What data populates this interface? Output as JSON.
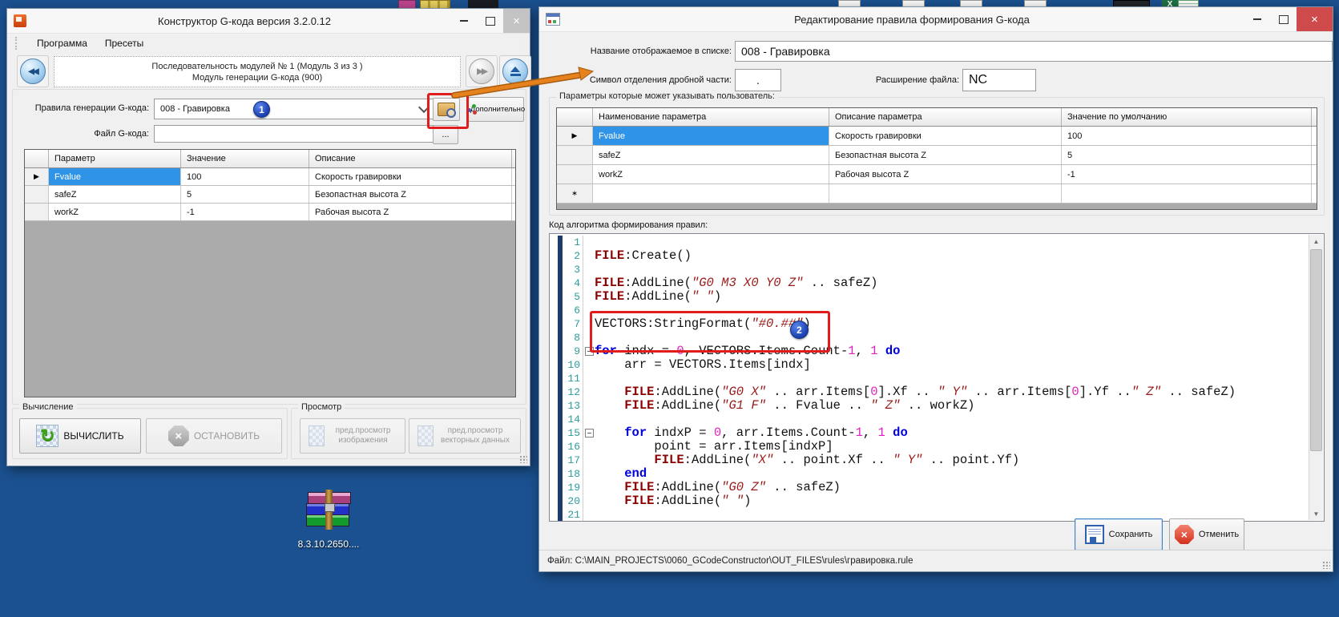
{
  "desktop": {
    "winrar_icon_label": "8.3.10.2650...."
  },
  "colors": {
    "desktop_bg": "#1b5190",
    "selection_blue": "#2f93e8",
    "annotation_red": "#e01d1d",
    "annotation_orange": "#e5821e",
    "close_button_red": "#cf4b4b",
    "code_keyword": "#0000dd",
    "code_type": "#8b0000",
    "code_string": "#9b1a1a",
    "code_number": "#e020c0",
    "line_number_teal": "#2c9c9c"
  },
  "left_window": {
    "title": "Конструктор G-кода версия 3.2.0.12",
    "menu": [
      "Программа",
      "Пресеты"
    ],
    "nav": {
      "line1": "Последовательность модулей № 1 (Модуль 3 из 3 )",
      "line2": "Модуль генерации G-кода (900)"
    },
    "fields": {
      "rules_label": "Правила генерации G-кода:",
      "rules_value": "008 - Гравировка",
      "badge1": "1",
      "advanced_label": "Дополнительно",
      "file_label": "Файл G-кода:",
      "file_value": "",
      "browse_label": "..."
    },
    "table": {
      "columns": [
        "Параметр",
        "Значение",
        "Описание"
      ],
      "rows": [
        {
          "cells": [
            "Fvalue",
            "100",
            "Скорость гравировки"
          ],
          "selected": true
        },
        {
          "cells": [
            "safeZ",
            "5",
            "Безопастная высота Z"
          ],
          "selected": false
        },
        {
          "cells": [
            "workZ",
            "-1",
            "Рабочая высота Z"
          ],
          "selected": false
        }
      ]
    },
    "compute_group": {
      "label": "Вычисление",
      "run_label": "ВЫЧИСЛИТЬ",
      "stop_label": "ОСТАНОВИТЬ"
    },
    "preview_group": {
      "label": "Просмотр",
      "preview_image_label": "пред.просмотр изображения",
      "preview_vector_label": "пред.просмотр векторных данных"
    }
  },
  "right_window": {
    "title": "Редактирование правила формирования G-кода",
    "fields": {
      "name_label": "Название отображаемое в списке:",
      "name_value": "008 - Гравировка",
      "decimal_label": "Символ отделения дробной части:",
      "decimal_value": ".",
      "ext_label": "Расширение файла:",
      "ext_value": "NC"
    },
    "params_group": {
      "label": "Параметры которые может указывать пользователь:",
      "columns": [
        "Наименование параметра",
        "Описание параметра",
        "Значение по умолчанию"
      ],
      "rows": [
        {
          "cells": [
            "Fvalue",
            "Скорость гравировки",
            "100"
          ],
          "selected": true
        },
        {
          "cells": [
            "safeZ",
            "Безопастная высота Z",
            "5"
          ],
          "selected": false
        },
        {
          "cells": [
            "workZ",
            "Рабочая высота Z",
            "-1"
          ],
          "selected": false
        }
      ],
      "new_row_glyph": "∗"
    },
    "code": {
      "label": "Код алгоритма формирования правил:",
      "badge2": "2",
      "lines": [
        {
          "n": "1",
          "seg": []
        },
        {
          "n": "2",
          "seg": [
            [
              "t",
              "FILE"
            ],
            [
              "p",
              ":Create()"
            ]
          ]
        },
        {
          "n": "3",
          "seg": []
        },
        {
          "n": "4",
          "seg": [
            [
              "t",
              "FILE"
            ],
            [
              "p",
              ":AddLine("
            ],
            [
              "s",
              "\"G0 M3 X0 Y0 Z\""
            ],
            [
              "p",
              " .. safeZ)"
            ]
          ]
        },
        {
          "n": "5",
          "seg": [
            [
              "t",
              "FILE"
            ],
            [
              "p",
              ":AddLine("
            ],
            [
              "s",
              "\" \""
            ],
            [
              "p",
              ")"
            ]
          ]
        },
        {
          "n": "6",
          "seg": []
        },
        {
          "n": "7",
          "seg": [
            [
              "p",
              "VECTORS:StringFormat("
            ],
            [
              "s",
              "\"#0.##\""
            ],
            [
              "p",
              ")"
            ]
          ]
        },
        {
          "n": "8",
          "seg": []
        },
        {
          "n": "9",
          "fold": true,
          "seg": [
            [
              "k",
              "for"
            ],
            [
              "p",
              " indx = "
            ],
            [
              "m",
              "0"
            ],
            [
              "p",
              ", VECTORS.Items.Count-"
            ],
            [
              "m",
              "1"
            ],
            [
              "p",
              ", "
            ],
            [
              "m",
              "1"
            ],
            [
              "p",
              " "
            ],
            [
              "k",
              "do"
            ]
          ]
        },
        {
          "n": "10",
          "seg": [
            [
              "p",
              "    arr = VECTORS.Items[indx]"
            ]
          ]
        },
        {
          "n": "11",
          "seg": []
        },
        {
          "n": "12",
          "seg": [
            [
              "p",
              "    "
            ],
            [
              "t",
              "FILE"
            ],
            [
              "p",
              ":AddLine("
            ],
            [
              "s",
              "\"G0 X\""
            ],
            [
              "p",
              " .. arr.Items["
            ],
            [
              "m",
              "0"
            ],
            [
              "p",
              "].Xf .. "
            ],
            [
              "s",
              "\" Y\""
            ],
            [
              "p",
              " .. arr.Items["
            ],
            [
              "m",
              "0"
            ],
            [
              "p",
              "].Yf .."
            ],
            [
              "s",
              "\" Z\""
            ],
            [
              "p",
              " .. safeZ)"
            ]
          ]
        },
        {
          "n": "13",
          "seg": [
            [
              "p",
              "    "
            ],
            [
              "t",
              "FILE"
            ],
            [
              "p",
              ":AddLine("
            ],
            [
              "s",
              "\"G1 F\""
            ],
            [
              "p",
              " .. Fvalue .. "
            ],
            [
              "s",
              "\" Z\""
            ],
            [
              "p",
              " .. workZ)"
            ]
          ]
        },
        {
          "n": "14",
          "seg": []
        },
        {
          "n": "15",
          "fold": true,
          "seg": [
            [
              "p",
              "    "
            ],
            [
              "k",
              "for"
            ],
            [
              "p",
              " indxP = "
            ],
            [
              "m",
              "0"
            ],
            [
              "p",
              ", arr.Items.Count-"
            ],
            [
              "m",
              "1"
            ],
            [
              "p",
              ", "
            ],
            [
              "m",
              "1"
            ],
            [
              "p",
              " "
            ],
            [
              "k",
              "do"
            ]
          ]
        },
        {
          "n": "16",
          "seg": [
            [
              "p",
              "        point = arr.Items[indxP]"
            ]
          ]
        },
        {
          "n": "17",
          "seg": [
            [
              "p",
              "        "
            ],
            [
              "t",
              "FILE"
            ],
            [
              "p",
              ":AddLine("
            ],
            [
              "s",
              "\"X\""
            ],
            [
              "p",
              " .. point.Xf .. "
            ],
            [
              "s",
              "\" Y\""
            ],
            [
              "p",
              " .. point.Yf)"
            ]
          ]
        },
        {
          "n": "18",
          "seg": [
            [
              "p",
              "    "
            ],
            [
              "k",
              "end"
            ]
          ]
        },
        {
          "n": "19",
          "seg": [
            [
              "p",
              "    "
            ],
            [
              "t",
              "FILE"
            ],
            [
              "p",
              ":AddLine("
            ],
            [
              "s",
              "\"G0 Z\""
            ],
            [
              "p",
              " .. safeZ)"
            ]
          ]
        },
        {
          "n": "20",
          "seg": [
            [
              "p",
              "    "
            ],
            [
              "t",
              "FILE"
            ],
            [
              "p",
              ":AddLine("
            ],
            [
              "s",
              "\" \""
            ],
            [
              "p",
              ")"
            ]
          ]
        },
        {
          "n": "21",
          "seg": []
        }
      ]
    },
    "buttons": {
      "save": "Сохранить",
      "cancel": "Отменить"
    },
    "statusbar": "Файл: C:\\MAIN_PROJECTS\\0060_GCodeConstructor\\OUT_FILES\\rules\\гравировка.rule"
  }
}
